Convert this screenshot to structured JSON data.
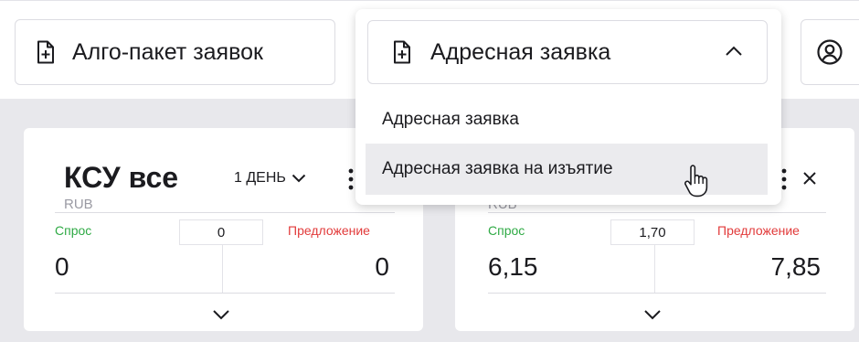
{
  "toolbar": {
    "algo_label": "Алго-пакет заявок",
    "address_label": "Адресная заявка"
  },
  "dropdown": {
    "items": [
      {
        "label": "Адресная заявка"
      },
      {
        "label": "Адресная заявка на изъятие"
      }
    ]
  },
  "cards": [
    {
      "title": "КСУ все",
      "currency": "RUB",
      "period": "1 ДЕНЬ",
      "bid_label": "Спрос",
      "ask_label": "Предложение",
      "spread": "0",
      "bid_value": "0",
      "ask_value": "0"
    },
    {
      "currency": "RUB",
      "bid_label": "Спрос",
      "ask_label": "Предложение",
      "spread": "1,70",
      "bid_value": "6,15",
      "ask_value": "7,85"
    }
  ],
  "colors": {
    "bid": "#2faa45",
    "ask": "#e23b3b",
    "workarea": "#e8e8ec",
    "hover": "#ebebee"
  }
}
